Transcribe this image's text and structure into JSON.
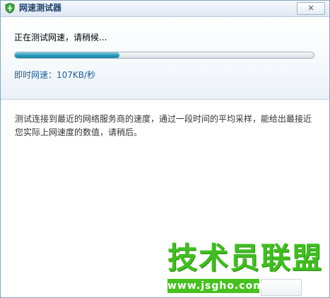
{
  "window": {
    "title": "网速测试器",
    "icon": "shield-icon",
    "close_label": "✕"
  },
  "test": {
    "status": "正在测试网速，请稍候...",
    "progress_percent": 35,
    "speed_label": "即时网速：",
    "speed_value": "107KB/秒"
  },
  "description": "测试连接到最近的网络服务商的速度，通过一段时间的平均采样，能给出最接近您实际上网速度的数值，请稍后。",
  "watermark": {
    "brand": "技术员联盟",
    "url": "www.jsgho.com"
  },
  "colors": {
    "accent": "#2a9ab8",
    "speed_text": "#1d5d9c",
    "watermark_green": "#46c11f"
  }
}
